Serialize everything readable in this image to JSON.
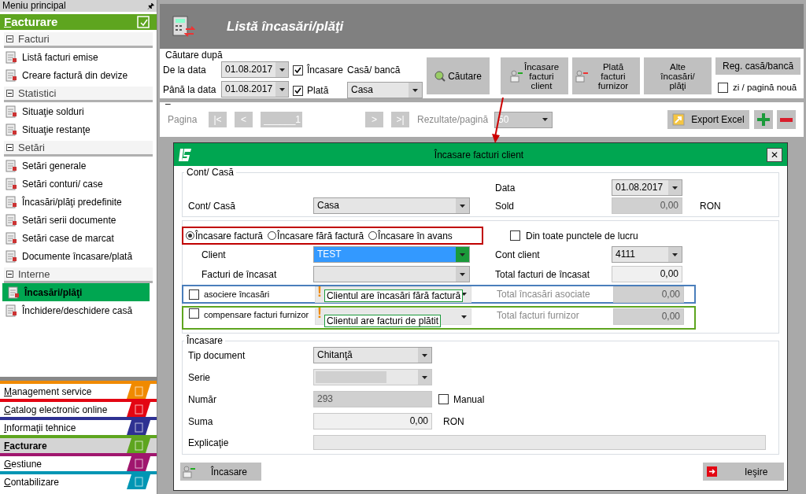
{
  "sidebar": {
    "title": "Meniu principal",
    "pin": "🖈",
    "module_title": "Facturare",
    "groups": [
      {
        "label": "Facturi",
        "expanded": true,
        "items": [
          {
            "label": "Listă facturi emise",
            "selected": false
          },
          {
            "label": "Creare factură din devize",
            "selected": false
          }
        ]
      },
      {
        "label": "Statistici",
        "expanded": true,
        "items": [
          {
            "label": "Situaţie solduri",
            "selected": false
          },
          {
            "label": "Situaţie restanţe",
            "selected": false
          }
        ]
      },
      {
        "label": "Setări",
        "expanded": true,
        "items": [
          {
            "label": "Setări generale",
            "selected": false
          },
          {
            "label": "Setări conturi/ case",
            "selected": false
          },
          {
            "label": "Încasări/plăţi predefinite",
            "selected": false
          },
          {
            "label": "Setări serii documente",
            "selected": false
          },
          {
            "label": "Setări case de marcat",
            "selected": false
          },
          {
            "label": "Documente încasare/plată",
            "selected": false
          }
        ]
      },
      {
        "label": "Interne",
        "expanded": true,
        "items": [
          {
            "label": "Încasări/plăţi",
            "selected": true
          },
          {
            "label": "Închidere/deschidere casă",
            "selected": false
          }
        ]
      }
    ],
    "modules": [
      {
        "label": "Management service",
        "color": "#f08a00",
        "selected": false
      },
      {
        "label": "Catalog electronic online",
        "color": "#e30613",
        "selected": false
      },
      {
        "label": "Informaţii tehnice",
        "color": "#2e3192",
        "selected": false
      },
      {
        "label": "Facturare",
        "color": "#5ea51f",
        "selected": true
      },
      {
        "label": "Gestiune",
        "color": "#a0166e",
        "selected": false
      },
      {
        "label": "Contabilizare",
        "color": "#0096b4",
        "selected": false
      }
    ]
  },
  "header": {
    "title": "Listă încasări/plăţi"
  },
  "search": {
    "legend": "Căutare după",
    "from_label": "De la data",
    "from_value": "01.08.2017",
    "to_label": "Până la data",
    "to_value": "01.08.2017",
    "checks": [
      {
        "label": "Încasare",
        "checked": true
      },
      {
        "label": "Plată",
        "checked": true
      }
    ],
    "cash_label": "Casă/ bancă",
    "cash_value": "Casa",
    "search_button": "Căutare",
    "actions": [
      {
        "label": "Încasare facturi client"
      },
      {
        "label": "Plată facturi furnizor"
      },
      {
        "label": "Alte încasări/ plăţi"
      }
    ],
    "register_button": "Reg. casă/bancă",
    "new_page": {
      "label": "zi / pagină nouă",
      "checked": false
    }
  },
  "pager": {
    "legend": "–",
    "page_label": "Pagina",
    "first": "|<",
    "prev": "<",
    "page": "______1",
    "next": ">",
    "last": ">|",
    "results_label": "Rezultate/pagină",
    "results_value": "50",
    "export": "Export Excel"
  },
  "dialog": {
    "title": "Încasare facturi client",
    "close": "✕",
    "cont": {
      "legend": "Cont/ Casă",
      "date_label": "Data",
      "date_value": "01.08.2017",
      "account_label": "Cont/ Casă",
      "account_value": "Casa",
      "sold_label": "Sold",
      "sold_value": "0,00",
      "currency": "RON"
    },
    "payment_types": [
      {
        "label": "Încasare factură",
        "selected": true
      },
      {
        "label": "Încasare fără factură",
        "selected": false
      },
      {
        "label": "Încasare în avans",
        "selected": false
      }
    ],
    "all_points": {
      "label": "Din toate punctele de lucru",
      "checked": false
    },
    "client_label": "Client",
    "client_value": "TEST",
    "client_account_label": "Cont client",
    "client_account_value": "4111",
    "invoices_label": "Facturi de încasat",
    "invoices_total_label": "Total facturi de încasat",
    "invoices_total_value": "0,00",
    "options": [
      {
        "label": "asociere încasări",
        "checked": false,
        "color": "#4a7ebb",
        "total_label": "Total încasări asociate",
        "total_value": "0,00",
        "disabled": true,
        "warning": "!",
        "note": "Clientul are încasări fără factură"
      },
      {
        "label": "compensare facturi furnizor",
        "checked": false,
        "color": "#5ea51f",
        "total_label": "Total facturi furnizor",
        "total_value": "0,00",
        "disabled": true,
        "warning": "!",
        "note": "Clientul are facturi de plătit"
      }
    ],
    "payment": {
      "legend": "Încasare",
      "doc_type_label": "Tip document",
      "doc_type_value": "Chitanţă",
      "series_label": "Serie",
      "number_label": "Număr",
      "number_value": "293",
      "manual": {
        "label": "Manual",
        "checked": false
      },
      "sum_label": "Suma",
      "sum_value": "0,00",
      "currency": "RON",
      "explanation_label": "Explicaţie"
    },
    "buttons": {
      "submit": "Încasare",
      "exit": "Ieşire"
    }
  }
}
